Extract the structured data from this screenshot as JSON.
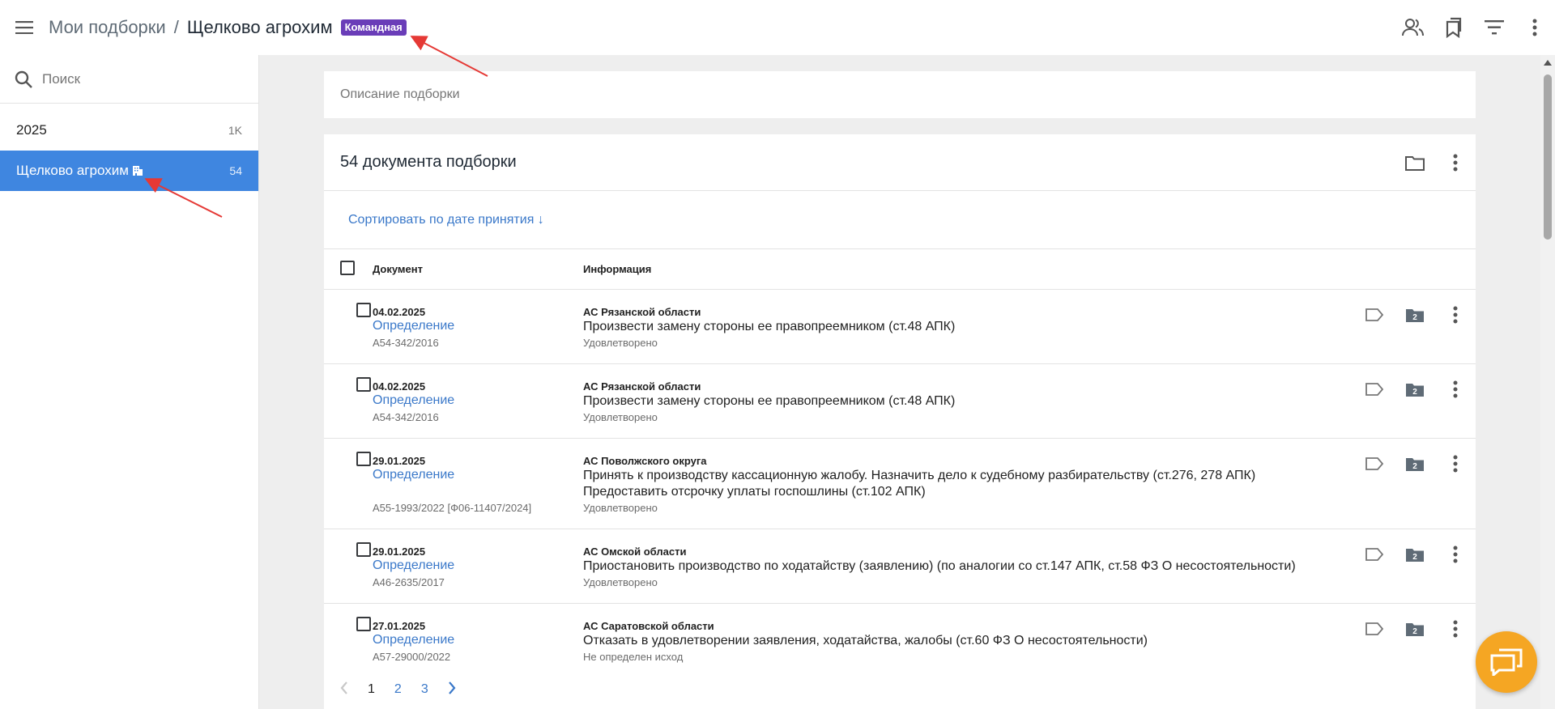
{
  "header": {
    "breadcrumb_root": "Мои подборки",
    "breadcrumb_sep": "/",
    "breadcrumb_current": "Щелково агрохим",
    "badge": "Командная"
  },
  "sidebar": {
    "search_placeholder": "Поиск",
    "items": [
      {
        "label": "2025",
        "count": "1K"
      },
      {
        "label": "Щелково агрохим",
        "count": "54"
      }
    ]
  },
  "main": {
    "description_placeholder": "Описание подборки",
    "docs_title": "54 документа подборки",
    "sort_label": "Сортировать по дате принятия ↓",
    "columns": {
      "document": "Документ",
      "info": "Информация"
    },
    "rows": [
      {
        "date": "04.02.2025",
        "type": "Определение",
        "number": "А54-342/2016",
        "court": "АС Рязанской области",
        "lines": [
          "Произвести замену стороны ее правопреемником (ст.48 АПК)"
        ],
        "status": "Удовлетворено",
        "folder_count": "2"
      },
      {
        "date": "04.02.2025",
        "type": "Определение",
        "number": "А54-342/2016",
        "court": "АС Рязанской области",
        "lines": [
          "Произвести замену стороны ее правопреемником (ст.48 АПК)"
        ],
        "status": "Удовлетворено",
        "folder_count": "2"
      },
      {
        "date": "29.01.2025",
        "type": "Определение",
        "number": "А55-1993/2022 [Ф06-11407/2024]",
        "court": "АС Поволжского округа",
        "lines": [
          "Принять к производству кассационную жалобу. Назначить дело к судебному разбирательству (ст.276, 278 АПК)",
          "Предоставить отсрочку уплаты госпошлины (ст.102 АПК)"
        ],
        "status": "Удовлетворено",
        "folder_count": "2"
      },
      {
        "date": "29.01.2025",
        "type": "Определение",
        "number": "А46-2635/2017",
        "court": "АС Омской области",
        "lines": [
          "Приостановить производство по ходатайству (заявлению) (по аналогии со ст.147 АПК, ст.58 ФЗ О несостоятельности)"
        ],
        "status": "Удовлетворено",
        "folder_count": "2"
      },
      {
        "date": "27.01.2025",
        "type": "Определение",
        "number": "А57-29000/2022",
        "court": "АС Саратовской области",
        "lines": [
          "Отказать в удовлетворении заявления, ходатайства, жалобы (ст.60 ФЗ О несостоятельности)"
        ],
        "status": "Не определен исход",
        "folder_count": "2"
      }
    ],
    "pagination": {
      "pages": [
        "1",
        "2",
        "3"
      ],
      "current": "1"
    }
  },
  "colors": {
    "accent": "#3f86e0",
    "badge": "#6a3db8",
    "link": "#3a78c9",
    "fab": "#f5a623",
    "annotation": "#e53935"
  }
}
